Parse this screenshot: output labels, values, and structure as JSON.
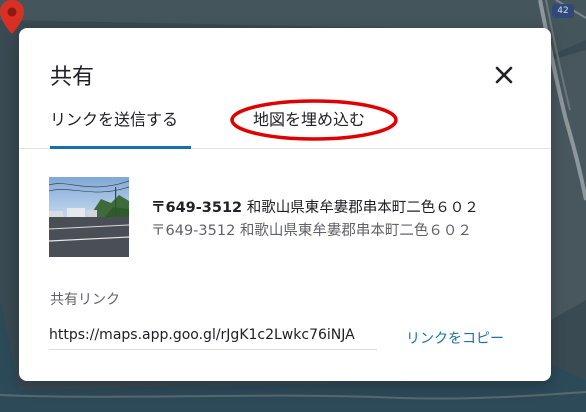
{
  "map": {
    "route_badge": "42"
  },
  "dialog": {
    "title": "共有",
    "tabs": [
      {
        "label": "リンクを送信する",
        "active": true
      },
      {
        "label": "地図を埋め込む",
        "active": false,
        "highlighted": true
      }
    ],
    "place": {
      "zip_bold": "〒649-3512",
      "address_main_rest": " 和歌山県東牟婁郡串本町二色６０２",
      "address_sub": "〒649-3512 和歌山県東牟婁郡串本町二色６０２"
    },
    "share": {
      "label": "共有リンク",
      "link_value": "https://maps.app.goo.gl/rJgK1c2Lwkc76iNJA",
      "copy_label": "リンクをコピー"
    }
  },
  "colors": {
    "accent": "#1a6fb0",
    "link": "#1973a7",
    "highlight_ring": "#e00000",
    "pin": "#d93025"
  }
}
